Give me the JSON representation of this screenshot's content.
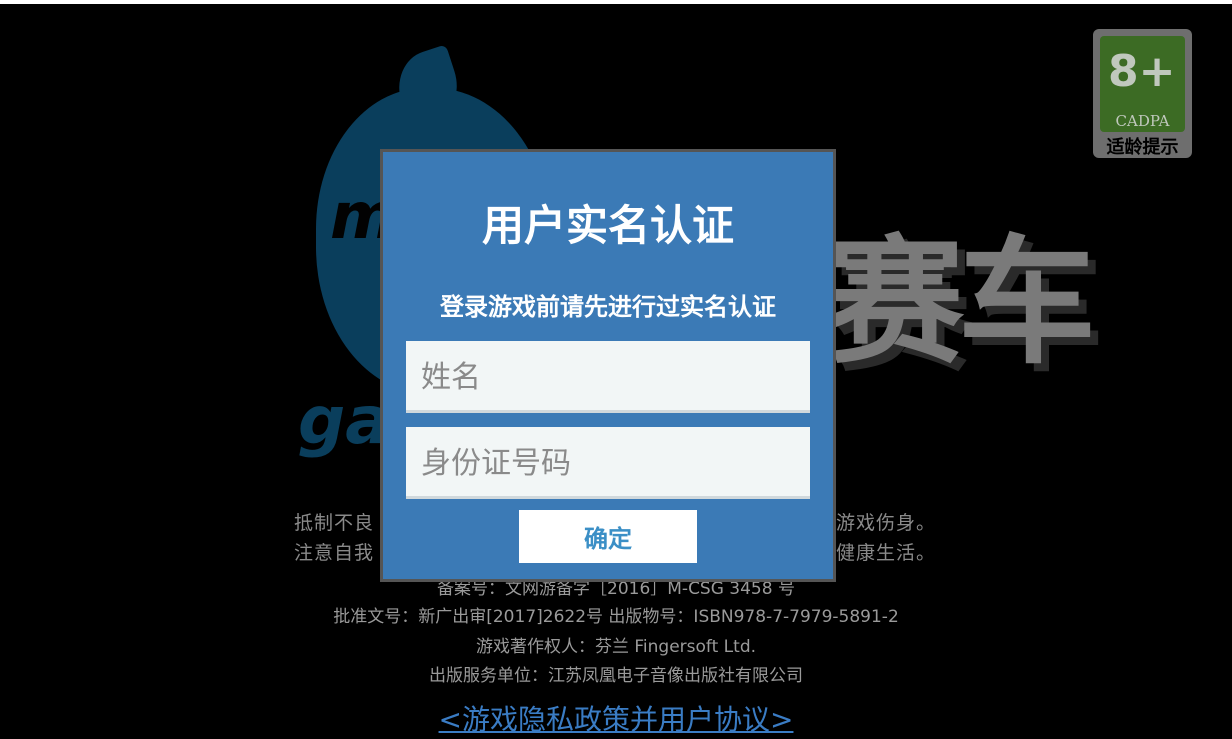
{
  "age_badge": {
    "number": "8+",
    "org": "CADPA",
    "label": "适龄提示"
  },
  "background": {
    "logo_text_face": "m",
    "logo_text_game": "ga",
    "game_title_visible": "赛车",
    "notice_line_1_left": "抵制不良",
    "notice_line_1_right": "游戏伤身。",
    "notice_line_2_left": "注意自我",
    "notice_line_2_right": "健康生活。",
    "record_number": "备案号：文网游备字［2016］M-CSG 3458 号",
    "approval": "批准文号：新广出审[2017]2622号 出版物号：ISBN978-7-7979-5891-2",
    "copyright": "游戏著作权人：芬兰 Fingersoft Ltd.",
    "publisher": "出版服务单位：江苏凤凰电子音像出版社有限公司",
    "privacy_link": "<游戏隐私政策并用户协议>"
  },
  "modal": {
    "title": "用户实名认证",
    "subtitle": "登录游戏前请先进行过实名认证",
    "name_placeholder": "姓名",
    "id_placeholder": "身份证号码",
    "confirm_label": "确定"
  },
  "colors": {
    "modal_bg": "#3b7ab6",
    "confirm_text": "#3b8fc6",
    "badge_green": "#3c6b24"
  }
}
